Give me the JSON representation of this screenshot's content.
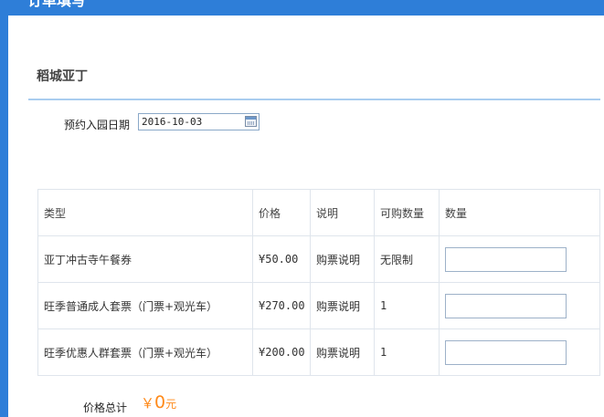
{
  "header": {
    "title": "订单填写"
  },
  "section": {
    "title": "稻城亚丁"
  },
  "date": {
    "label": "预约入园日期",
    "value": "2016-10-03"
  },
  "table": {
    "headers": [
      "类型",
      "价格",
      "说明",
      "可购数量",
      "数量"
    ],
    "rows": [
      {
        "type": "亚丁冲古寺午餐券",
        "price": "¥50.00",
        "note": "购票说明",
        "limit": "无限制",
        "qty": ""
      },
      {
        "type": "旺季普通成人套票（门票+观光车）",
        "price": "¥270.00",
        "note": "购票说明",
        "limit": "1",
        "qty": ""
      },
      {
        "type": "旺季优惠人群套票（门票+观光车）",
        "price": "¥200.00",
        "note": "购票说明",
        "limit": "1",
        "qty": ""
      }
    ]
  },
  "total": {
    "label": "价格总计",
    "currency": "￥",
    "amount": "0",
    "unit": "元"
  },
  "colors": {
    "accent": "#2e7ed8",
    "price": "#ff8a1a",
    "rule": "#a9cdef"
  }
}
